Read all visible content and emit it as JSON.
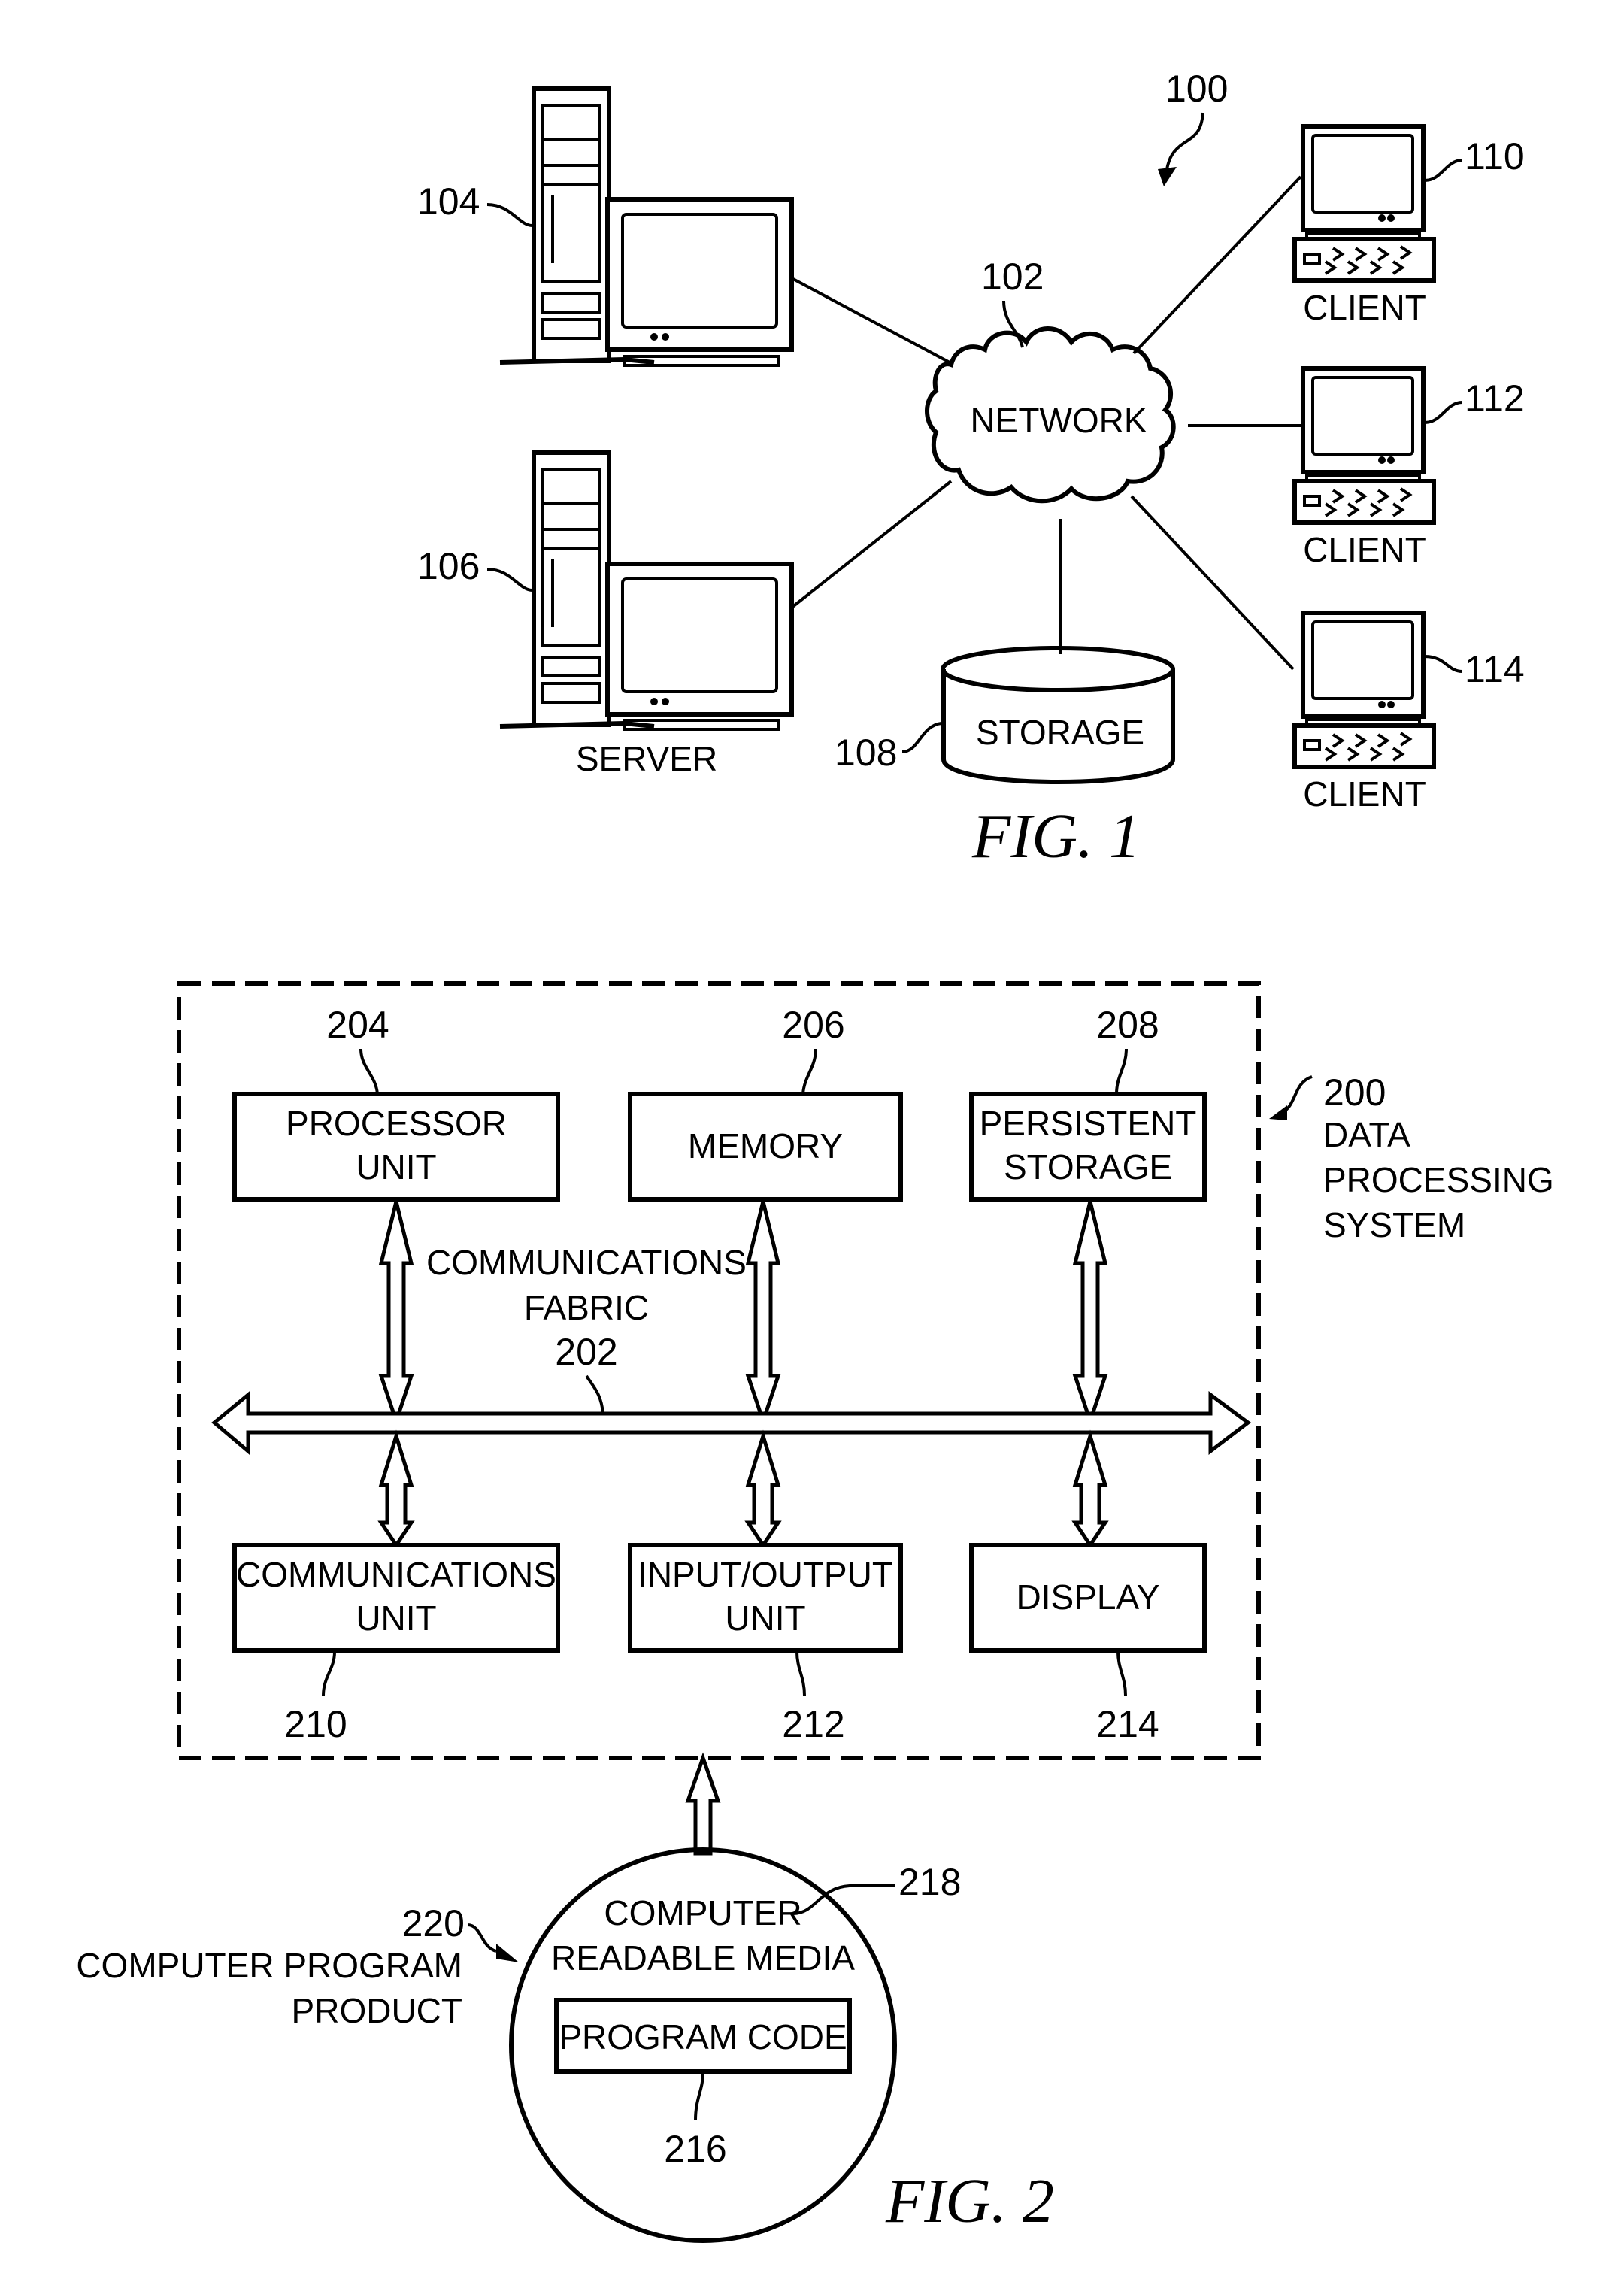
{
  "fig1": {
    "caption": "FIG. 1",
    "system_ref": "100",
    "network": {
      "ref": "102",
      "label": "NETWORK"
    },
    "servers": [
      {
        "ref": "104"
      },
      {
        "ref": "106",
        "label": "SERVER"
      }
    ],
    "storage": {
      "ref": "108",
      "label": "STORAGE"
    },
    "clients": [
      {
        "ref": "110",
        "label": "CLIENT"
      },
      {
        "ref": "112",
        "label": "CLIENT"
      },
      {
        "ref": "114",
        "label": "CLIENT"
      }
    ]
  },
  "fig2": {
    "caption": "FIG. 2",
    "system": {
      "ref": "200",
      "label_lines": [
        "DATA",
        "PROCESSING",
        "SYSTEM"
      ]
    },
    "fabric": {
      "label_lines": [
        "COMMUNICATIONS",
        "FABRIC"
      ],
      "ref": "202"
    },
    "top_units": [
      {
        "ref": "204",
        "label_lines": [
          "PROCESSOR",
          "UNIT"
        ]
      },
      {
        "ref": "206",
        "label_lines": [
          "MEMORY"
        ]
      },
      {
        "ref": "208",
        "label_lines": [
          "PERSISTENT",
          "STORAGE"
        ]
      }
    ],
    "bottom_units": [
      {
        "ref": "210",
        "label_lines": [
          "COMMUNICATIONS",
          "UNIT"
        ]
      },
      {
        "ref": "212",
        "label_lines": [
          "INPUT/OUTPUT",
          "UNIT"
        ]
      },
      {
        "ref": "214",
        "label_lines": [
          "DISPLAY"
        ]
      }
    ],
    "program_product": {
      "ref": "220",
      "label_lines": [
        "COMPUTER PROGRAM",
        "PRODUCT"
      ]
    },
    "media": {
      "ref": "218",
      "label_lines": [
        "COMPUTER",
        "READABLE MEDIA"
      ]
    },
    "program_code": {
      "ref": "216",
      "label": "PROGRAM CODE"
    }
  }
}
